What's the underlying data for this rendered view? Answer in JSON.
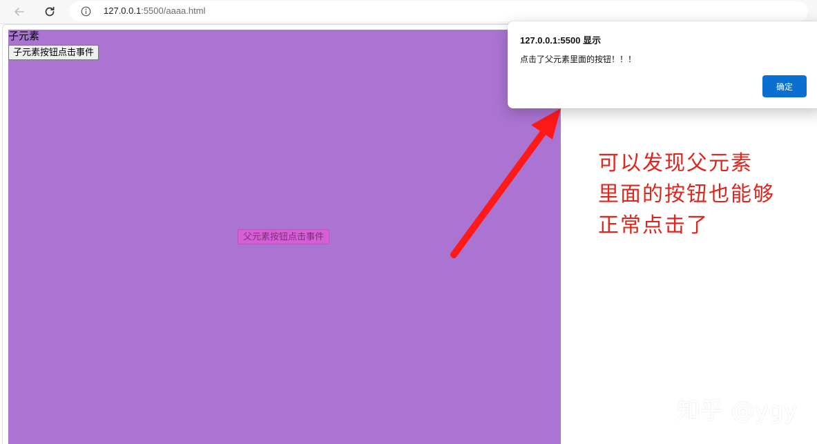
{
  "browser": {
    "url_host": "127.0.0.1",
    "url_rest": ":5500/aaaa.html"
  },
  "page": {
    "child_label": "子元素",
    "child_button_label": "子元素按钮点击事件",
    "parent_button_label": "父元素按钮点击事件",
    "parent_color": "#ab74d3"
  },
  "dialog": {
    "title": "127.0.0.1:5500 显示",
    "message": "点击了父元素里面的按钮！！！",
    "ok_label": "确定",
    "accent_color": "#0b6fd1"
  },
  "annotation": {
    "lines": [
      "可以发现父元素",
      "里面的按钮也能够",
      "正常点击了"
    ],
    "color": "#e0261c"
  },
  "watermark": "知乎 @ygy"
}
